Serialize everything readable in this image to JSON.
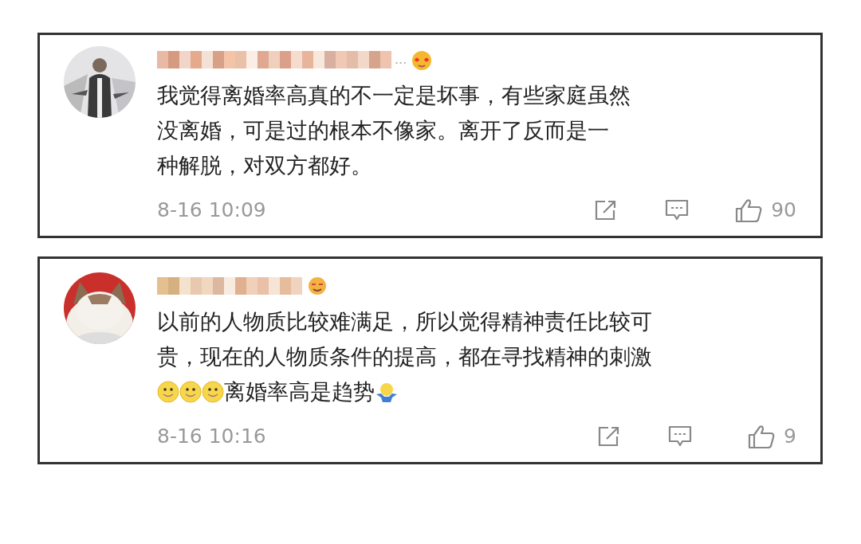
{
  "comments": [
    {
      "avatar": {
        "kind": "picture"
      },
      "username_suffix": "...",
      "badge": {
        "kind": "heart-face"
      },
      "lines": [
        [
          {
            "kind": "text",
            "text": "我觉得离婚率高真的不一定是坏事，有些家庭虽然"
          }
        ],
        [
          {
            "kind": "text",
            "text": "没离婚，可是过的根本不像家。离开了反而是一"
          }
        ],
        [
          {
            "kind": "text",
            "text": "种解脱，对双方都好。"
          }
        ]
      ],
      "time": "8-16 10:09",
      "likes": "90"
    },
    {
      "avatar": {
        "kind": "picture"
      },
      "badge": {
        "kind": "grin-face"
      },
      "lines": [
        [
          {
            "kind": "text",
            "text": "以前的人物质比较难满足，所以觉得精神责任比较可"
          }
        ],
        [
          {
            "kind": "text",
            "text": "贵，现在的人物质条件的提高，都在寻找精神的刺激"
          }
        ],
        [
          {
            "kind": "smiley"
          },
          {
            "kind": "smiley"
          },
          {
            "kind": "smiley"
          },
          {
            "kind": "text",
            "text": "离婚率高是趋势"
          },
          {
            "kind": "shrug"
          }
        ]
      ],
      "time": "8-16 10:16",
      "likes": "9"
    }
  ]
}
